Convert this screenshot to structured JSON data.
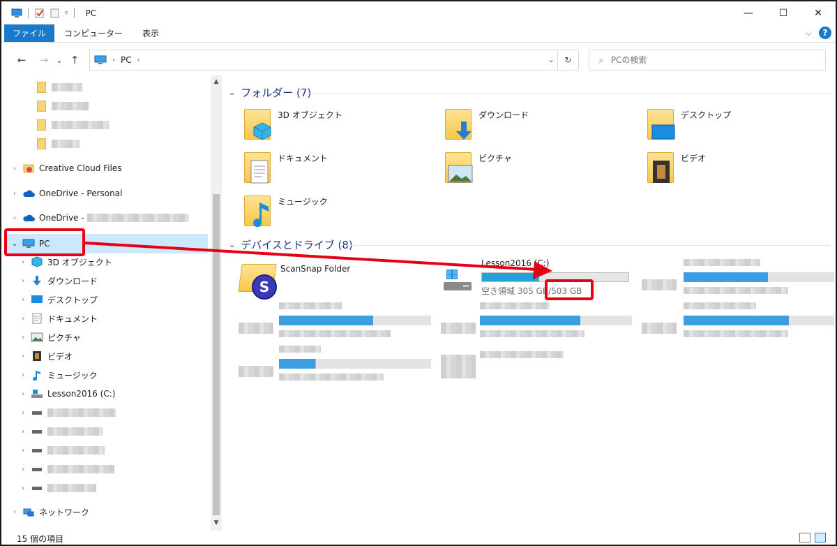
{
  "window": {
    "title": "PC",
    "controls": {
      "minimize": "—",
      "maximize": "☐",
      "close": "✕"
    }
  },
  "ribbon": {
    "tabs": [
      {
        "label": "ファイル",
        "active": true
      },
      {
        "label": "コンピューター"
      },
      {
        "label": "表示"
      }
    ],
    "help": "?",
    "expand": "⌵"
  },
  "nav": {
    "back": "←",
    "forward": "→",
    "recent": "⌄",
    "up": "↑",
    "breadcrumb": [
      "PC"
    ],
    "search_placeholder": "PCの検索"
  },
  "tree": {
    "creative_cloud": "Creative Cloud Files",
    "onedrive_personal": "OneDrive - Personal",
    "onedrive_business": "OneDrive -",
    "pc": "PC",
    "pc_children": [
      "3D オブジェクト",
      "ダウンロード",
      "デスクトップ",
      "ドキュメント",
      "ピクチャ",
      "ビデオ",
      "ミュージック",
      "Lesson2016 (C:)"
    ],
    "network": "ネットワーク"
  },
  "content": {
    "folders_header": "フォルダー (7)",
    "folders": [
      "3D オブジェクト",
      "ダウンロード",
      "デスクトップ",
      "ドキュメント",
      "ピクチャ",
      "ビデオ",
      "ミュージック"
    ],
    "devices_header": "デバイスとドライブ (8)",
    "scansnap": "ScanSnap Folder",
    "drive_c": {
      "name": "Lesson2016 (C:)",
      "free_text": "空き領域 305 GB/503 GB",
      "used_fraction": 0.39
    }
  },
  "status": {
    "item_count": "15 個の項目"
  },
  "colors": {
    "accent": "#1979ca",
    "annotation": "#e60012",
    "selection": "#cce8ff",
    "drive_fill": "#26a0da"
  }
}
